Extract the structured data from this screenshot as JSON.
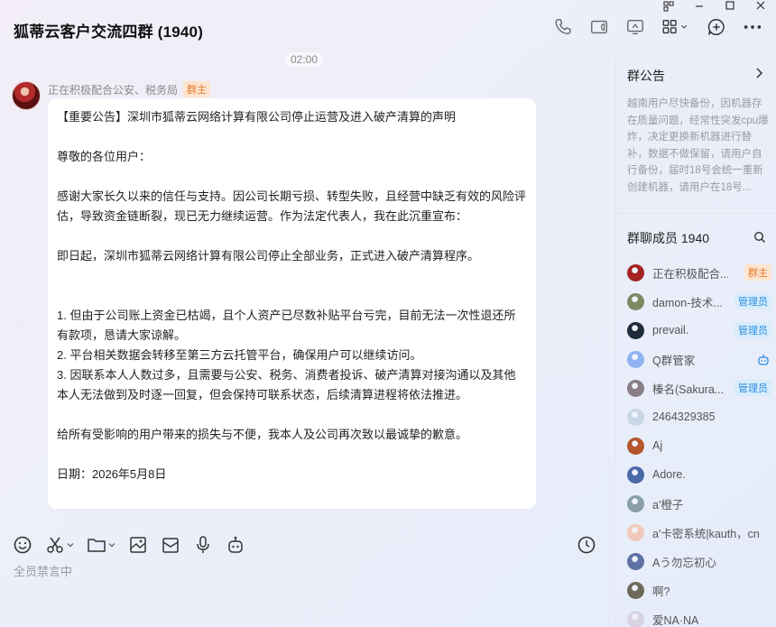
{
  "header": {
    "title": "狐蒂云客户交流四群 (1940)"
  },
  "chat": {
    "time": "02:00",
    "message": {
      "sender": "正在积极配合公安、税务局",
      "sender_badge": "群主",
      "lines": [
        "【重要公告】深圳市狐蒂云网络计算有限公司停止运营及进入破产清算的声明",
        "",
        "尊敬的各位用户：",
        "",
        "感谢大家长久以来的信任与支持。因公司长期亏损、转型失败，且经营中缺乏有效的风险评估，导致资金链断裂，现已无力继续运营。作为法定代表人，我在此沉重宣布：",
        "",
        "即日起，深圳市狐蒂云网络计算有限公司停止全部业务，正式进入破产清算程序。",
        "",
        "",
        "1. 但由于公司账上资金已枯竭，且个人资产已尽数补贴平台亏完，目前无法一次性退还所有款项，恳请大家谅解。",
        "2. 平台相关数据会转移至第三方云托管平台，确保用户可以继续访问。",
        "3. 因联系本人人数过多，且需要与公安、税务、消费者投诉、破产清算对接沟通以及其他本人无法做到及时逐一回复，但会保持可联系状态，后续清算进程将依法推进。",
        "",
        "给所有受影响的用户带来的损失与不便，我本人及公司再次致以最诚挚的歉意。",
        "",
        "日期：2026年5月8日"
      ]
    }
  },
  "compose": {
    "muted_text": "全员禁言中"
  },
  "panel": {
    "notice_title": "群公告",
    "notice_body": "越南用户尽快备份，因机器存在质量问题，经常性突发cpu爆炸，决定更换新机器进行替补，数据不做保留，请用户自行备份，届时18号会统一重新创建机器，请用户在18号...",
    "members_title": "群聊成员 1940",
    "members": [
      {
        "name": "正在积极配合...",
        "badge": "群主",
        "badge_type": "owner",
        "color": "#a42424"
      },
      {
        "name": "damon-技术...",
        "badge": "管理员",
        "badge_type": "admin",
        "color": "#7c8a62"
      },
      {
        "name": "prevail.",
        "badge": "管理员",
        "badge_type": "admin",
        "color": "#1f2a3a"
      },
      {
        "name": "Q群管家",
        "badge": "",
        "badge_type": "bot",
        "color": "#8fb3f0"
      },
      {
        "name": "榛名(Sakura...",
        "badge": "管理员",
        "badge_type": "admin",
        "color": "#8a7d86"
      },
      {
        "name": "2464329385",
        "badge": "",
        "badge_type": "",
        "color": "#c9d6e6"
      },
      {
        "name": "Aj",
        "badge": "",
        "badge_type": "",
        "color": "#b5562c"
      },
      {
        "name": "Adore.",
        "badge": "",
        "badge_type": "",
        "color": "#4b6aa8"
      },
      {
        "name": "a'橙子",
        "badge": "",
        "badge_type": "",
        "color": "#8aa0a8"
      },
      {
        "name": "a'卡密系统|kauth，cn",
        "badge": "",
        "badge_type": "",
        "color": "#f1c9b9"
      },
      {
        "name": "Aう勿忘初心",
        "badge": "",
        "badge_type": "",
        "color": "#5f72a6"
      },
      {
        "name": "啊?",
        "badge": "",
        "badge_type": "",
        "color": "#6d6a5a"
      },
      {
        "name": "爱NA·NA",
        "badge": "",
        "badge_type": "",
        "color": "#d7d3e0"
      }
    ]
  }
}
